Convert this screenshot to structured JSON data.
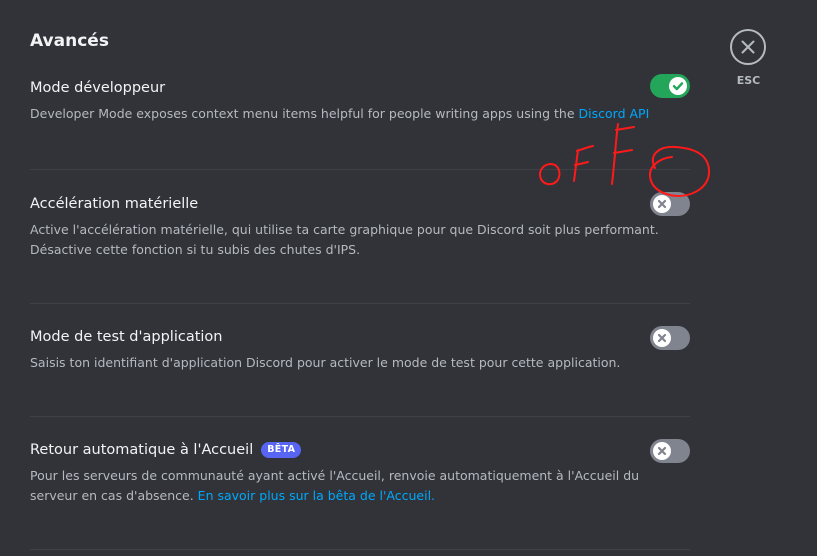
{
  "section_title": "Avancés",
  "close": {
    "label": "ESC",
    "icon": "close-icon"
  },
  "settings": [
    {
      "title": "Mode développeur",
      "desc": "Developer Mode exposes context menu items helpful for people writing apps using the ",
      "link": "Discord API",
      "desc_after": "",
      "toggle": "on"
    },
    {
      "title": "Accélération matérielle",
      "desc": "Active l'accélération matérielle, qui utilise ta carte graphique pour que Discord soit plus performant. Désactive cette fonction si tu subis des chutes d'IPS.",
      "toggle": "off"
    },
    {
      "title": "Mode de test d'application",
      "desc": "Saisis ton identifiant d'application Discord pour activer le mode de test pour cette application.",
      "toggle": "off"
    },
    {
      "title": "Retour automatique à l'Accueil",
      "badge": "BÊTA",
      "desc": "Pour les serveurs de communauté ayant activé l'Accueil, renvoie automatiquement à l'Accueil du serveur en cas d'absence. ",
      "link": "En savoir plus sur la bêta de l'Accueil.",
      "toggle": "off"
    }
  ],
  "annotation": {
    "text": "OFF",
    "color": "#ff1a1a"
  },
  "colors": {
    "background": "#313338",
    "toggle_on": "#23a55a",
    "toggle_off": "#80848e",
    "link": "#00a8fc",
    "badge": "#5865f2"
  }
}
